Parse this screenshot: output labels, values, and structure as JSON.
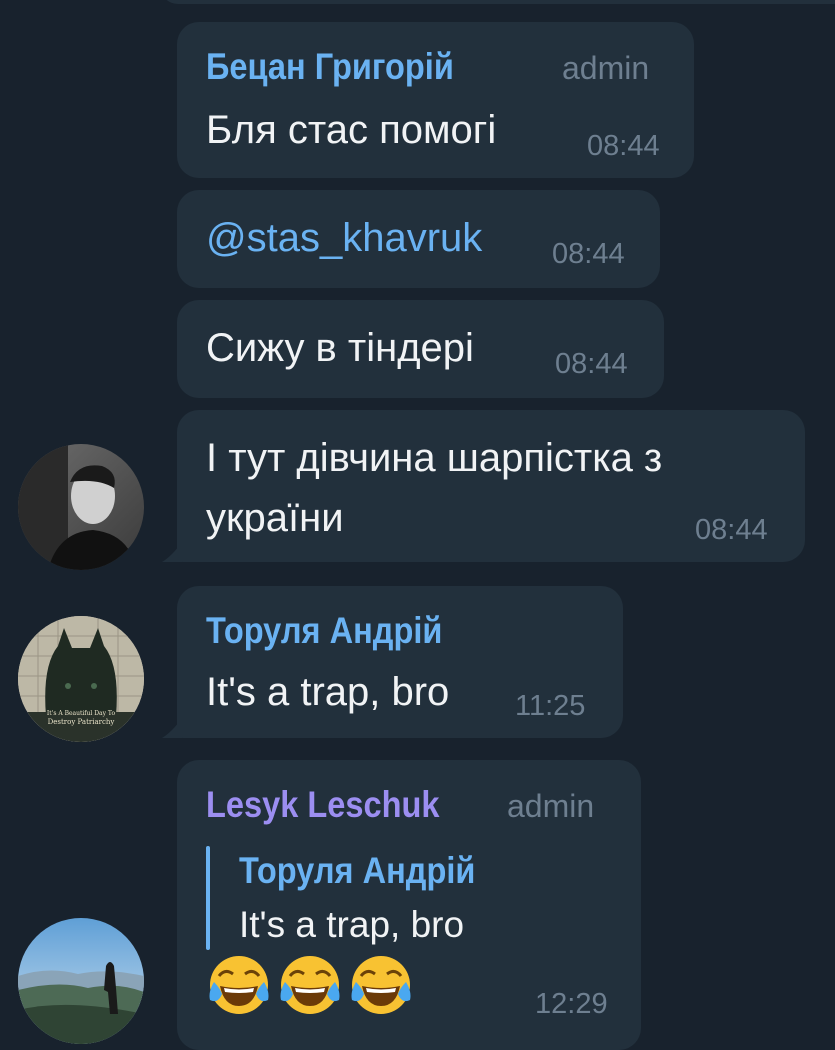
{
  "messages": [
    {
      "sender": "Бецан Григорій",
      "badge": "admin",
      "text": "Бля стас помогі",
      "time": "08:44"
    },
    {
      "text": "@stas_khavruk",
      "time": "08:44"
    },
    {
      "text": "Сижу в тіндері",
      "time": "08:44"
    },
    {
      "text_line1": "І тут дівчина шарпістка з",
      "text_line2": "україни",
      "time": "08:44"
    },
    {
      "sender": "Торуля Андрій",
      "text": "It's a trap, bro",
      "time": "11:25",
      "avatar_caption_line1": "It's A Beautiful Day To",
      "avatar_caption_line2": "Destroy Patriarchy"
    },
    {
      "sender": "Lesyk Leschuk",
      "badge": "admin",
      "reply": {
        "sender": "Торуля Андрій",
        "text": "It's a trap, bro"
      },
      "emojis": [
        "face-with-tears-of-joy",
        "face-with-tears-of-joy",
        "face-with-tears-of-joy"
      ],
      "time": "12:29"
    }
  ],
  "colors": {
    "background": "#18222d",
    "bubble": "#22303c",
    "sender_blue": "#6ab2f2",
    "sender_purple": "#9c8ef1",
    "meta_gray": "#6e7f90",
    "text": "#f1f3f5"
  }
}
